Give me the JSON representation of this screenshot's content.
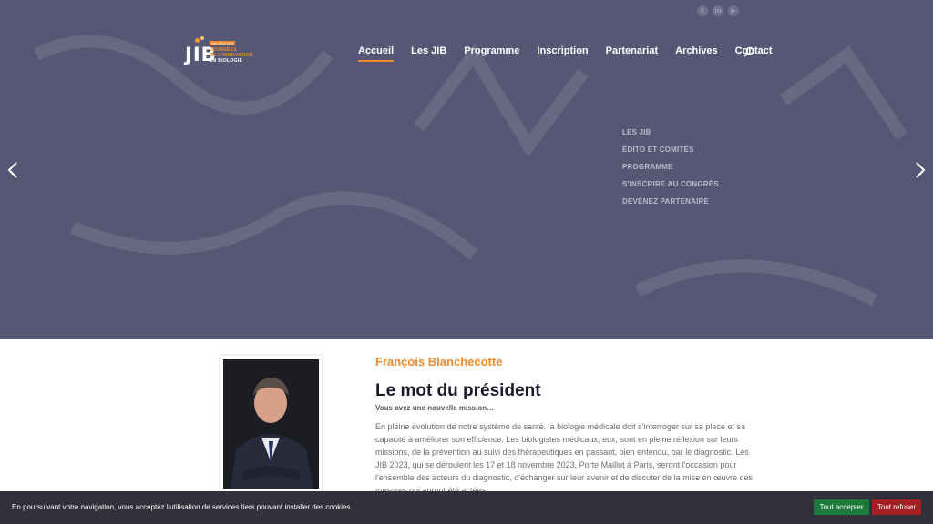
{
  "header": {
    "social": [
      {
        "icon": "twitter-icon",
        "glyph": "t"
      },
      {
        "icon": "linkedin-icon",
        "glyph": "in"
      },
      {
        "icon": "youtube-icon",
        "glyph": "▶"
      }
    ],
    "logo": {
      "mark": "JIB",
      "badge": "16e ÉDITION",
      "line1": "JOURNÉES",
      "line2": "DE L'INNOVATION",
      "line3": "EN BIOLOGIE"
    },
    "nav": [
      {
        "label": "Accueil",
        "active": true
      },
      {
        "label": "Les JIB",
        "active": false
      },
      {
        "label": "Programme",
        "active": false
      },
      {
        "label": "Inscription",
        "active": false
      },
      {
        "label": "Partenariat",
        "active": false
      },
      {
        "label": "Archives",
        "active": false
      },
      {
        "label": "Contact",
        "active": false
      }
    ]
  },
  "hero": {
    "quick_links": [
      "LES JIB",
      "ÉDITO ET COMITÉS",
      "PROGRAMME",
      "S'INSCRIRE AU CONGRÈS",
      "DEVENEZ PARTENAIRE"
    ],
    "background_color": "#565774"
  },
  "president": {
    "name": "François Blanchecotte",
    "title": "Le mot du président",
    "subtitle": "Vous avez une nouvelle mission…",
    "paragraph": "En pleine évolution de notre système de santé, la biologie médicale doit s'interroger sur sa place et sa capacité à améliorer son efficience. Les biologistes médicaux, eux, sont en pleine réflexion sur leurs missions, de la prévention au suivi des thérapeutiques en passant, bien entendu, par le diagnostic. Les JIB 2023, qui se déroulent les 17 et 18 novembre 2023, Porte Maillot à Paris, seront l'occasion pour l'ensemble des acteurs du diagnostic, d'échanger sur leur avenir et de discuter de la mise en œuvre des mesures qui auront été actées."
  },
  "cookie": {
    "text": "En poursuivant votre navigation, vous acceptez l'utilisation de services tiers pouvant installer des cookies.",
    "accept": "Tout accepter",
    "refuse": "Tout refuser"
  },
  "colors": {
    "accent": "#f18a2a",
    "accept": "#1e7a3a",
    "refuse": "#a51e24"
  }
}
